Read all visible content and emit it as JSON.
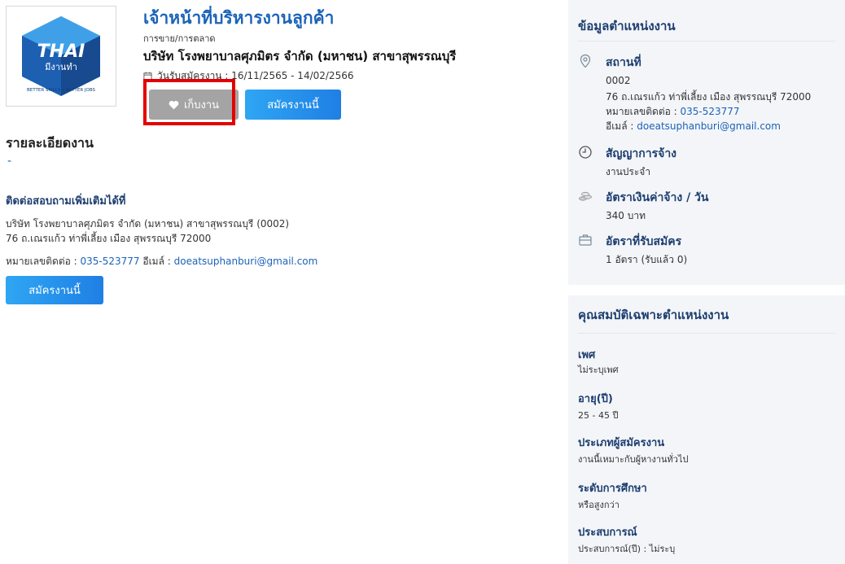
{
  "logo": {
    "text_main": "THAI",
    "text_sub": "มีงานทำ",
    "ring_text": "BETTER SKILLS • BETTER JOBS"
  },
  "job": {
    "title": "เจ้าหน้าที่บริหารงานลูกค้า",
    "category": "การขาย/การตลาด",
    "company": "บริษัท โรงพยาบาลศุภมิตร จำกัด (มหาชน) สาขาสุพรรณบุรี",
    "period_label": "วันรับสมัครงาน : 16/11/2565 - 14/02/2566"
  },
  "buttons": {
    "save": "เก็บงาน",
    "apply": "สมัครงานนี้"
  },
  "details": {
    "heading": "รายละเอียดงาน",
    "body": "-"
  },
  "contact": {
    "heading": "ติดต่อสอบถามเพิ่มเติมได้ที่",
    "line1": "บริษัท โรงพยาบาลศุภมิตร จำกัด (มหาชน) สาขาสุพรรณบุรี (0002)",
    "line2": "76 ถ.เณรแก้ว ท่าพี่เลี้ยง เมือง สุพรรณบุรี 72000",
    "phone_label": "หมายเลขติดต่อ : ",
    "phone": "035-523777",
    "email_label": " อีเมล์ : ",
    "email": "doeatsuphanburi@gmail.com"
  },
  "position_info": {
    "title": "ข้อมูลตำแหน่งงาน",
    "location": {
      "label": "สถานที่",
      "code": "0002",
      "address": "76 ถ.เณรแก้ว ท่าพี่เลี้ยง เมือง สุพรรณบุรี 72000",
      "phone_label": "หมายเลขติดต่อ : ",
      "phone": "035-523777",
      "email_label": "อีเมล์ : ",
      "email": "doeatsuphanburi@gmail.com"
    },
    "contract": {
      "label": "สัญญาการจ้าง",
      "value": "งานประจำ"
    },
    "wage": {
      "label": "อัตราเงินค่าจ้าง / วัน",
      "value": "340 บาท"
    },
    "openings": {
      "label": "อัตราที่รับสมัคร",
      "value": "1 อัตรา (รับแล้ว 0)"
    }
  },
  "qualifications": {
    "title": "คุณสมบัติเฉพาะตำแหน่งงาน",
    "items": [
      {
        "label": "เพศ",
        "value": "ไม่ระบุเพศ"
      },
      {
        "label": "อายุ(ปี)",
        "value": "25 - 45 ปี"
      },
      {
        "label": "ประเภทผู้สมัครงาน",
        "value": "งานนี้เหมาะกับผู้หางานทั่วไป"
      },
      {
        "label": "ระดับการศึกษา",
        "value": "หรือสูงกว่า"
      },
      {
        "label": "ประสบการณ์",
        "value": "ประสบการณ์(ปี) : ไม่ระบุ"
      }
    ]
  },
  "colors": {
    "accent": "#1b63b8",
    "heading_dark": "#1d3e70",
    "highlight_box": "#e40000",
    "save_button": "#a4a4a4",
    "apply_gradient_start": "#2fa6f3",
    "apply_gradient_end": "#1f7fe4",
    "sidebar_bg": "#f3f5f8"
  }
}
